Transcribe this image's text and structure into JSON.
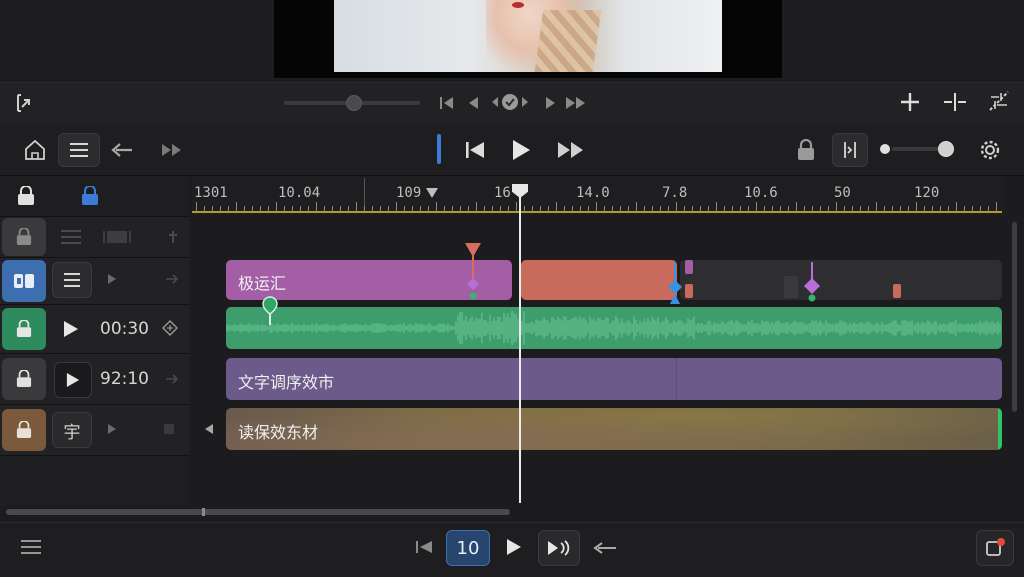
{
  "ruler": {
    "labels": [
      "1301",
      "10.04",
      "109",
      "16",
      "14.0",
      "7.8",
      "10.6",
      "50",
      "120"
    ]
  },
  "tracks": [
    {
      "id": "title",
      "lock_color": "#4a4a4c"
    },
    {
      "id": "video",
      "lock_color": "#3d6fb0"
    },
    {
      "id": "audio",
      "lock_color": "#2e8b5e",
      "time": "00:30"
    },
    {
      "id": "text",
      "lock_color": "#4a4a4c",
      "time": "92:10"
    },
    {
      "id": "effect",
      "lock_color": "#7a5a3a",
      "glyph": "宇"
    }
  ],
  "clips": {
    "video_1_label": "极运汇",
    "text_label": "文字调序效市",
    "effect_label": "读保效东材"
  },
  "bottom": {
    "frame_value": "10"
  },
  "colors": {
    "accent": "#3d7bd8",
    "video_clip": "#a45ea6",
    "video_clip_2": "#c86a5c",
    "audio_clip": "#3e9d6d",
    "text_clip": "#6b5a8a",
    "effect_clip": "#7a6a4a",
    "ruler_line": "#b39a2a"
  }
}
